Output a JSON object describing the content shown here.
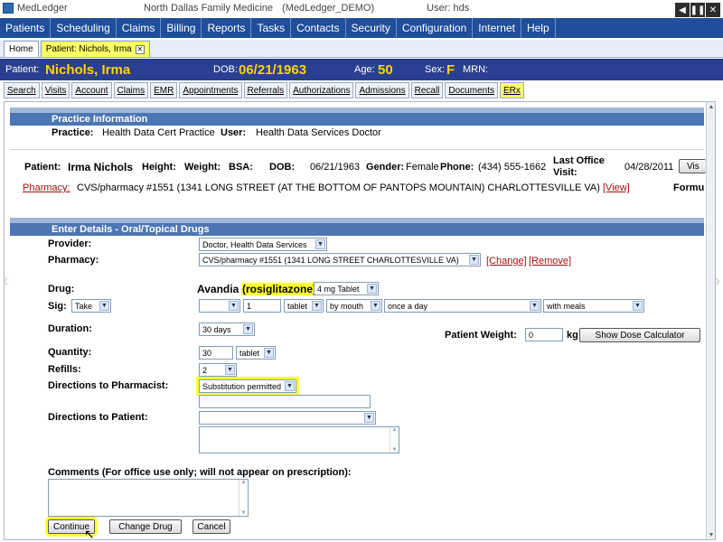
{
  "window": {
    "app_name": "MedLedger",
    "practice_name": "North Dallas Family Medicine",
    "instance": "(MedLedger_DEMO)",
    "user": "User: hds"
  },
  "menu": [
    "Patients",
    "Scheduling",
    "Claims",
    "Billing",
    "Reports",
    "Tasks",
    "Contacts",
    "Security",
    "Configuration",
    "Internet",
    "Help"
  ],
  "tabs": {
    "home": "Home",
    "patient": "Patient: Nichols, Irma"
  },
  "banner": {
    "patient_label": "Patient:",
    "patient_name": "Nichols, Irma",
    "dob_label": "DOB:",
    "dob": "06/21/1963",
    "age_label": "Age:",
    "age": "50",
    "sex_label": "Sex:",
    "sex": "F",
    "mrn_label": "MRN:"
  },
  "subtabs": [
    "Search",
    "Visits",
    "Account",
    "Claims",
    "EMR",
    "Appointments",
    "Referrals",
    "Authorizations",
    "Admissions",
    "Recall",
    "Documents",
    "ERx"
  ],
  "practice_info": {
    "heading": "Practice Information",
    "practice_label": "Practice:",
    "practice_value": "Health Data Cert Practice",
    "user_label": "User:",
    "user_value": "Health Data Services Doctor"
  },
  "patient_info": {
    "patient_label": "Patient:",
    "patient_name": "Irma Nichols",
    "height_label": "Height:",
    "weight_label": "Weight:",
    "bsa_label": "BSA:",
    "dob_label": "DOB:",
    "dob": "06/21/1963",
    "gender_label": "Gender:",
    "gender": "Female",
    "phone_label": "Phone:",
    "phone": "(434) 555-1662",
    "last_visit_label_1": "Last Office",
    "last_visit_label_2": "Visit:",
    "last_visit": "04/28/2011",
    "visit_button": "Vis",
    "pharmacy_label": "Pharmacy:",
    "pharmacy_value": "CVS/pharmacy #1551 (1341 LONG STREET (AT THE BOTTOM OF PANTOPS MOUNTAIN) CHARLOTTESVILLE VA)",
    "view_link": "[View]",
    "formulary_label": "Formu"
  },
  "details": {
    "heading": "Enter Details - Oral/Topical Drugs",
    "provider_label": "Provider:",
    "provider_value": "Doctor, Health Data Services",
    "pharmacy_label": "Pharmacy:",
    "pharmacy_value": "CVS/pharmacy #1551 (1341 LONG STREET CHARLOTTESVILLE VA)",
    "change_link": "[Change]",
    "remove_link": "[Remove]",
    "drug_label": "Drug:",
    "drug_name": "Avandia",
    "drug_generic": "(rosiglitazone)",
    "drug_strength": "4 mg Tablet",
    "sig_label": "Sig:",
    "sig_action": "Take",
    "sig_blank": "",
    "sig_qty": "1",
    "sig_unit": "tablet",
    "sig_route": "by mouth",
    "sig_frequency": "once a day",
    "sig_with": "with meals",
    "duration_label": "Duration:",
    "duration_value": "30 days",
    "patient_weight_label": "Patient Weight:",
    "patient_weight_value": "0",
    "weight_unit": "kg",
    "dose_calc_button": "Show Dose Calculator",
    "quantity_label": "Quantity:",
    "quantity_value": "30",
    "quantity_unit": "tablet",
    "refills_label": "Refills:",
    "refills_value": "2",
    "directions_pharmacist_label": "Directions to Pharmacist:",
    "directions_pharmacist_value": "Substitution permitted",
    "directions_patient_label": "Directions to Patient:",
    "comments_label": "Comments (For office use only; will not appear on prescription):",
    "continue_button": "Continue",
    "change_drug_button": "Change Drug",
    "cancel_button": "Cancel"
  },
  "colors": {
    "menu_bg": "#1f4e9a",
    "banner_bg": "#2a3f8f",
    "banner_value": "#ffd400",
    "section_head": "#4c76b3",
    "highlight": "#ffff33"
  }
}
